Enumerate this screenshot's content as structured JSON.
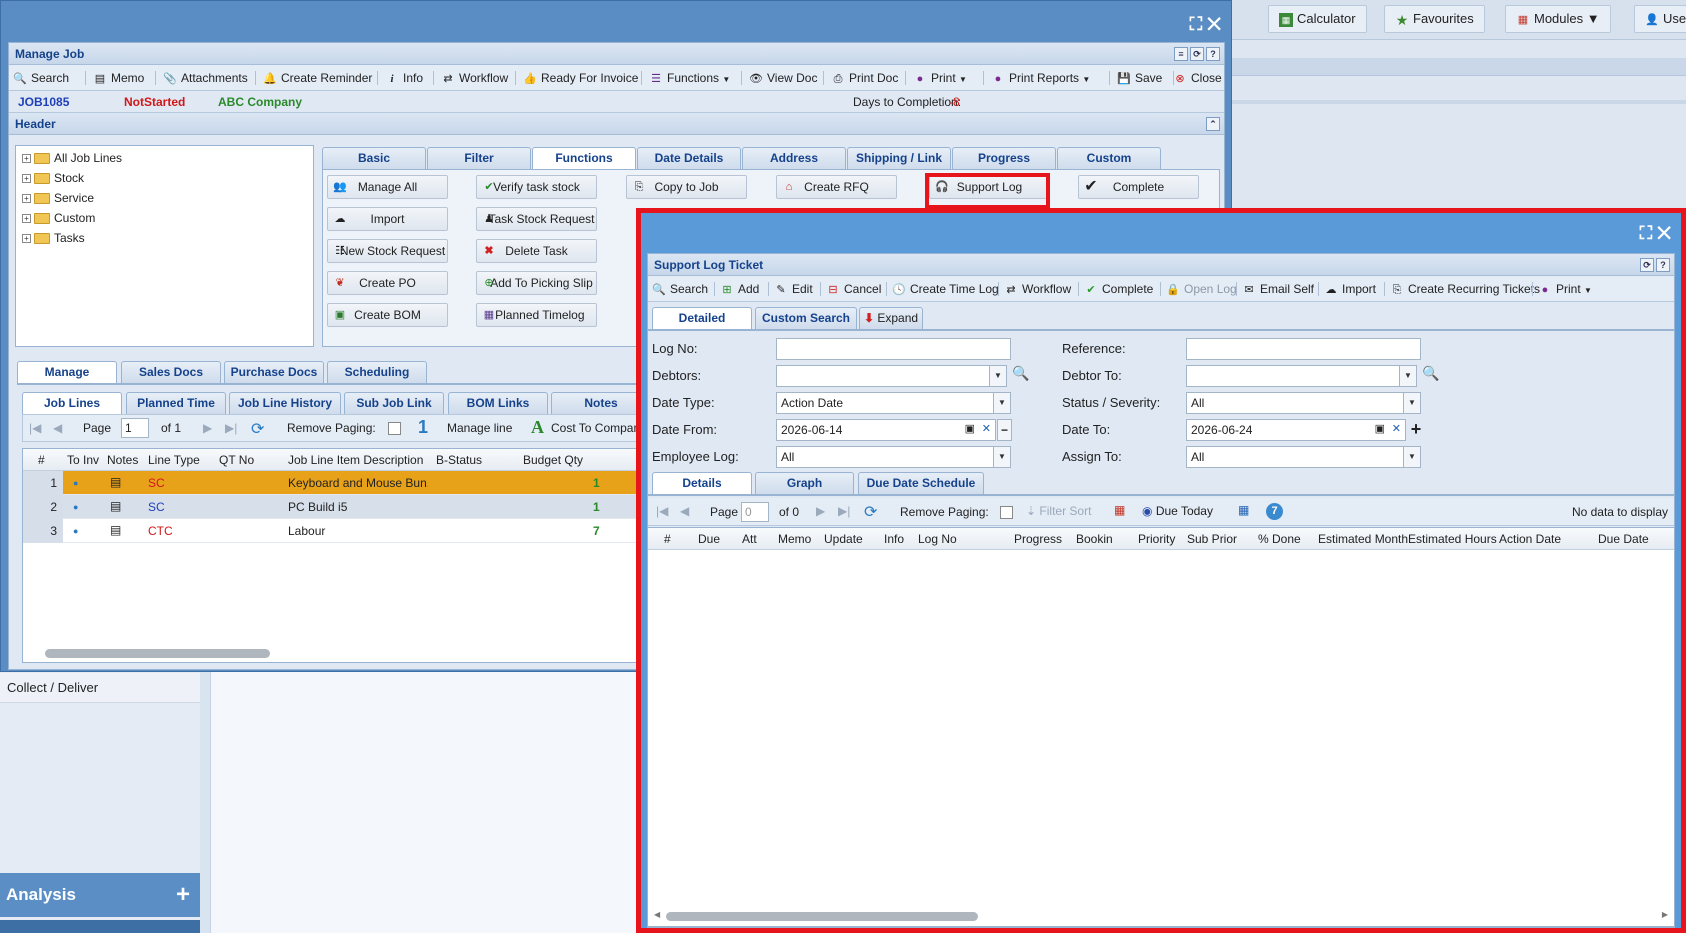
{
  "topbar": {
    "calculator": "Calculator",
    "favourites": "Favourites",
    "modules": "Modules",
    "user": "Use"
  },
  "leftnav": {
    "collect": "Collect / Deliver",
    "analysis": "Analysis"
  },
  "manage_job": {
    "title": "Manage Job",
    "toolbar": [
      "Search",
      "Memo",
      "Attachments",
      "Create Reminder",
      "Info",
      "Workflow",
      "Ready For Invoice",
      "Functions",
      "View Doc",
      "Print Doc",
      "Print",
      "Print Reports",
      "Save",
      "Close"
    ],
    "job_no": "JOB1085",
    "status": "NotStarted",
    "company": "ABC Company",
    "days_label": "Days to Completion:",
    "days_value": "-8",
    "header_title": "Header",
    "tree": [
      "All Job Lines",
      "Stock",
      "Service",
      "Custom",
      "Tasks"
    ],
    "header_tabs": [
      "Basic",
      "Filter",
      "Functions",
      "Date Details",
      "Address",
      "Shipping / Link",
      "Progress",
      "Custom"
    ],
    "functions": {
      "col1": [
        "Manage All",
        "Import",
        "New Stock Request",
        "Create PO",
        "Create BOM"
      ],
      "col2": [
        "Verify task stock",
        "Task Stock Request",
        "Delete Task",
        "Add To Picking Slip",
        "Planned Timelog"
      ],
      "col3": [
        "Copy to Job"
      ],
      "col4": [
        "Create RFQ"
      ],
      "col5": [
        "Support Log"
      ],
      "col6": [
        "Complete"
      ]
    },
    "bottom_tabs": [
      "Manage",
      "Sales Docs",
      "Purchase Docs",
      "Scheduling"
    ],
    "sub_tabs": [
      "Job Lines",
      "Planned Time",
      "Job Line History",
      "Sub Job Link",
      "BOM Links",
      "Notes"
    ],
    "paging": {
      "page_label": "Page",
      "page_value": "1",
      "of_label": "of 1",
      "remove_paging": "Remove Paging:",
      "count": "1",
      "manage_line": "Manage line",
      "cost_to_company": "Cost To Company"
    },
    "columns": [
      "#",
      "To Inv",
      "Notes",
      "Line Type",
      "QT No",
      "Job Line Item Description",
      "B-Status",
      "Budget Qty"
    ],
    "rows": [
      {
        "num": "1",
        "type": "SC",
        "desc": "Keyboard and Mouse Bun...",
        "qty": "1"
      },
      {
        "num": "2",
        "type": "SC",
        "desc": "PC Build i5",
        "qty": "1"
      },
      {
        "num": "3",
        "type": "CTC",
        "desc": "Labour",
        "qty": "7"
      }
    ]
  },
  "support_log": {
    "title": "Support Log Ticket",
    "toolbar": [
      "Search",
      "Add",
      "Edit",
      "Cancel",
      "Create Time Log",
      "Workflow",
      "Complete",
      "Open Log",
      "Email Self",
      "Import",
      "Create Recurring Tickets",
      "Print"
    ],
    "tabs": [
      "Detailed",
      "Custom Search",
      "Expand"
    ],
    "form": {
      "log_no_label": "Log No:",
      "log_no": "",
      "reference_label": "Reference:",
      "reference": "",
      "debtors_label": "Debtors:",
      "debtors": "",
      "debtor_to_label": "Debtor To:",
      "debtor_to": "",
      "date_type_label": "Date Type:",
      "date_type": "Action Date",
      "status_label": "Status / Severity:",
      "status": "All",
      "date_from_label": "Date From:",
      "date_from": "2026-06-14",
      "date_to_label": "Date To:",
      "date_to": "2026-06-24",
      "employee_log_label": "Employee Log:",
      "employee_log": "All",
      "assign_to_label": "Assign To:",
      "assign_to": "All"
    },
    "grid_tabs": [
      "Details",
      "Graph",
      "Due Date Schedule"
    ],
    "paging": {
      "page_label": "Page",
      "page_value": "0",
      "of_label": "of 0",
      "remove_paging": "Remove Paging:",
      "filter_sort": "Filter Sort",
      "due_today": "Due Today",
      "badge": "7",
      "no_data": "No data to display"
    },
    "columns": [
      "#",
      "Due",
      "Att",
      "Memo",
      "Update",
      "Info",
      "Log No",
      "Progress",
      "Bookin",
      "Priority",
      "Sub Prior",
      "% Done",
      "Estimated Month",
      "Estimated Hours",
      "Action Date",
      "Due Date"
    ]
  }
}
